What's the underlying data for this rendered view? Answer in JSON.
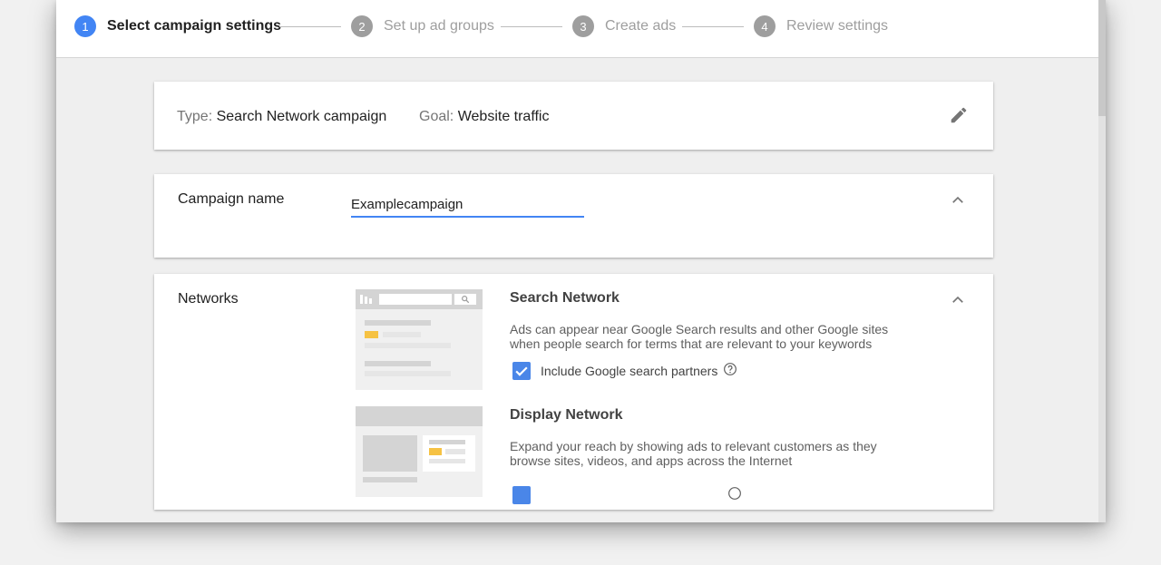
{
  "stepper": {
    "steps": [
      {
        "num": "1",
        "label": "Select campaign settings"
      },
      {
        "num": "2",
        "label": "Set up ad groups"
      },
      {
        "num": "3",
        "label": "Create ads"
      },
      {
        "num": "4",
        "label": "Review settings"
      }
    ],
    "active_step": 1
  },
  "summary": {
    "type_key": "Type:",
    "type_value": "Search Network campaign",
    "goal_key": "Goal:",
    "goal_value": "Website traffic"
  },
  "campaign_name": {
    "label": "Campaign name",
    "value": "Examplecampaign"
  },
  "networks": {
    "label": "Networks",
    "search": {
      "title": "Search Network",
      "description": "Ads can appear near Google Search results and other Google sites when people search for terms that are relevant to your keywords",
      "checkbox_label": "Include Google search partners",
      "checked": true
    },
    "display": {
      "title": "Display Network",
      "description": "Expand your reach by showing ads to relevant customers as they browse sites, videos, and apps across the Internet",
      "checked": true
    }
  },
  "icons": {
    "edit": "pencil-icon",
    "collapse": "chevron-up-icon",
    "help": "help-circle-icon",
    "check": "check-icon",
    "search": "search-icon"
  },
  "colors": {
    "accent": "#4285f4",
    "inactive_step": "#9e9e9e",
    "highlight": "#f6c243",
    "checkbox": "#4a86e8"
  }
}
